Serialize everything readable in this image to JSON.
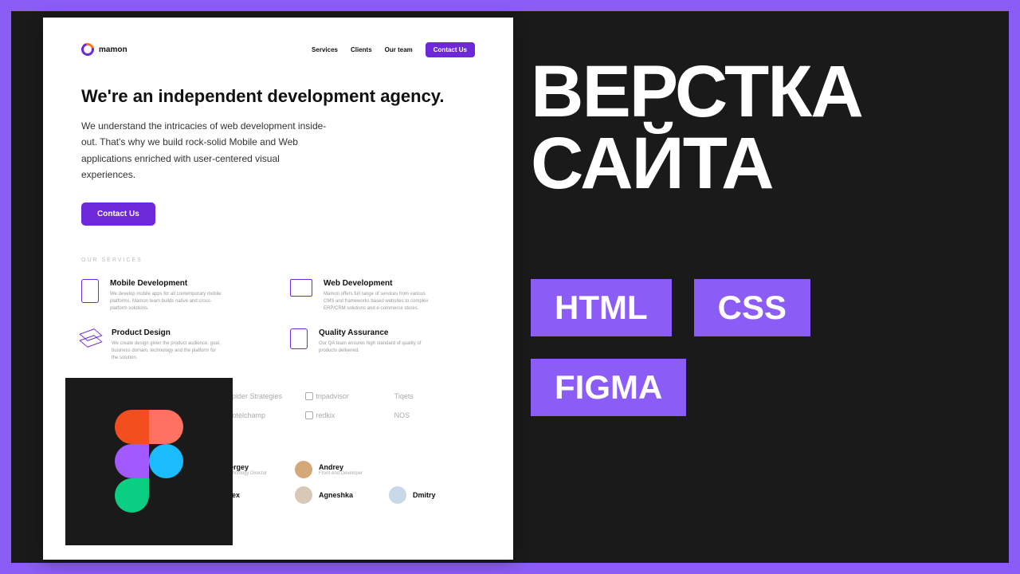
{
  "right": {
    "headline_l1": "ВЕРСТКА",
    "headline_l2": "САЙТА",
    "tags": [
      "HTML",
      "CSS",
      "FIGMA"
    ]
  },
  "mock": {
    "brand": "mamon",
    "nav": [
      "Services",
      "Clients",
      "Our team"
    ],
    "nav_cta": "Contact Us",
    "hero": {
      "title": "We're an independent development agency.",
      "body": "We understand the intricacies of web development inside-out. That's why we build rock-solid Mobile and Web applications enriched with user-centered visual experiences.",
      "cta": "Contact Us"
    },
    "section_label": "OUR SERVICES",
    "services": [
      {
        "title": "Mobile Development",
        "desc": "We develop mobile apps for all contemporary mobile platforms. Mamon team builds native and cross-platform solutions."
      },
      {
        "title": "Web Development",
        "desc": "Mamon offers full range of services from various CMS and frameworks based websites to complex ERP/CRM solutions and e-commerce stores."
      },
      {
        "title": "Product Design",
        "desc": "We create design given the product audience, goal, business domain, technology and the platform for the solution."
      },
      {
        "title": "Quality Assurance",
        "desc": "Our QA team ensures high standard of quality of products delivered."
      }
    ],
    "clients": [
      "Spider Strategies",
      "tripadvisor",
      "Tiqets",
      "Hotelchamp",
      "redkix",
      "NOS"
    ],
    "team": [
      {
        "name": "Sergey",
        "role": "Technology Director"
      },
      {
        "name": "Andrey",
        "role": "Front-end Developer"
      },
      {
        "name": "",
        "role": ""
      },
      {
        "name": "Alex",
        "role": ""
      },
      {
        "name": "Agneshka",
        "role": ""
      },
      {
        "name": "Dmitry",
        "role": ""
      }
    ]
  }
}
